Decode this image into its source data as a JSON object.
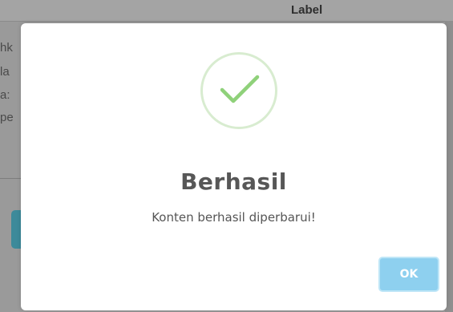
{
  "background": {
    "header_label": "Label",
    "text_fragments": [
      "hk",
      "la",
      "a:",
      "pe"
    ]
  },
  "dialog": {
    "icon": "check-icon",
    "title": "Berhasil",
    "message": "Konten berhasil diperbarui!",
    "ok_label": "OK"
  },
  "colors": {
    "success_ring": "#d8ecd0",
    "check": "#8fd17a",
    "ok_button": "#8ed0ef"
  }
}
